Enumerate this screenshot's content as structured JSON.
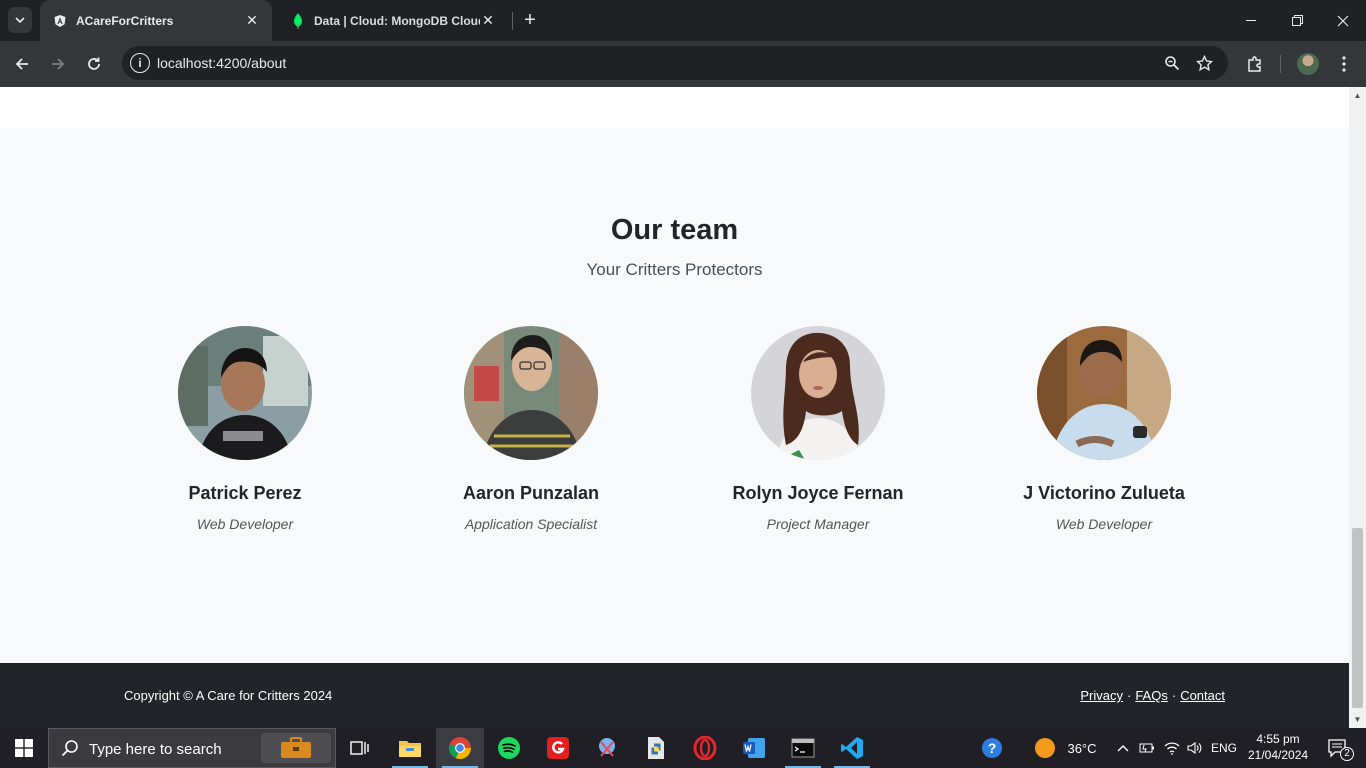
{
  "browser": {
    "tabs": [
      {
        "title": "ACareForCritters",
        "favicon": "angular-logo-icon",
        "active": true
      },
      {
        "title": "Data | Cloud: MongoDB Cloud",
        "favicon": "mongodb-leaf-icon",
        "active": false
      }
    ],
    "address": "localhost:4200/about"
  },
  "page": {
    "team_title": "Our team",
    "team_subtitle": "Your Critters Protectors",
    "members": [
      {
        "name": "Patrick Perez",
        "role": "Web Developer"
      },
      {
        "name": "Aaron Punzalan",
        "role": "Application Specialist"
      },
      {
        "name": "Rolyn Joyce Fernan",
        "role": "Project Manager"
      },
      {
        "name": "J Victorino Zulueta",
        "role": "Web Developer"
      }
    ],
    "footer": {
      "copyright": "Copyright © A Care for Critters 2024",
      "links": [
        "Privacy",
        "FAQs",
        "Contact"
      ],
      "separator": "·"
    }
  },
  "taskbar": {
    "search_placeholder": "Type here to search",
    "temperature": "36°C",
    "language": "ENG",
    "time": "4:55 pm",
    "date": "21/04/2024",
    "notification_count": "2"
  },
  "colors": {
    "chrome_dark": "#202124",
    "chrome_toolbar": "#35363a",
    "page_bg": "#f8f9fa",
    "footer_bg": "#212529",
    "taskbar_bg": "#1f1f25"
  }
}
